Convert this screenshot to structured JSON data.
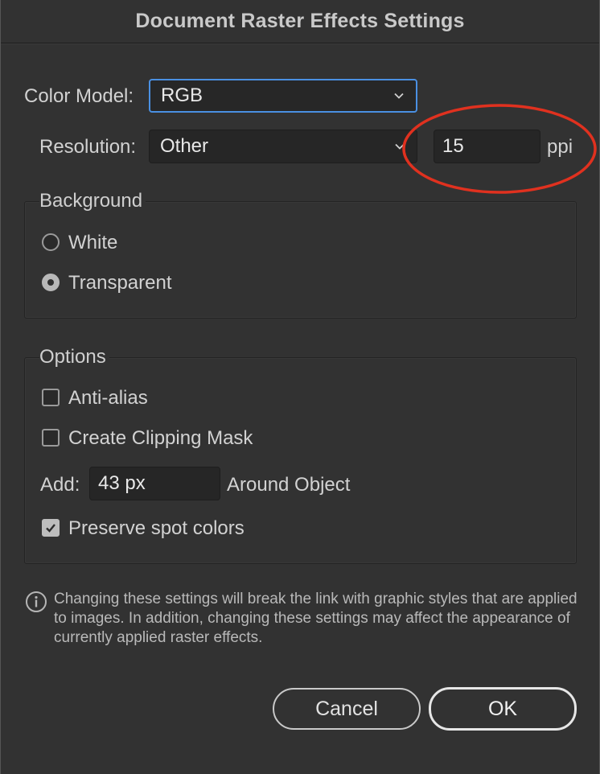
{
  "window": {
    "title": "Document Raster Effects Settings"
  },
  "color_model": {
    "label": "Color Model:",
    "value": "RGB"
  },
  "resolution": {
    "label": "Resolution:",
    "value": "Other",
    "ppi_value": "15",
    "unit": "ppi"
  },
  "background": {
    "title": "Background",
    "options": [
      {
        "label": "White",
        "checked": false
      },
      {
        "label": "Transparent",
        "checked": true
      }
    ]
  },
  "options": {
    "title": "Options",
    "anti_alias": {
      "label": "Anti-alias",
      "checked": false
    },
    "clipping_mask": {
      "label": "Create Clipping Mask",
      "checked": false
    },
    "add_label": "Add:",
    "add_value": "43 px",
    "around_label": "Around Object",
    "preserve_spot": {
      "label": "Preserve spot colors",
      "checked": true
    }
  },
  "info": {
    "icon": "info-icon",
    "text": "Changing these settings will break the link with graphic styles that are applied to images. In addition, changing these settings may affect the appearance of currently applied raster effects."
  },
  "buttons": {
    "cancel": "Cancel",
    "ok": "OK"
  },
  "colors": {
    "accent_focus": "#4a90e2",
    "annotation": "#e0311f",
    "dialog_bg": "#323232"
  }
}
